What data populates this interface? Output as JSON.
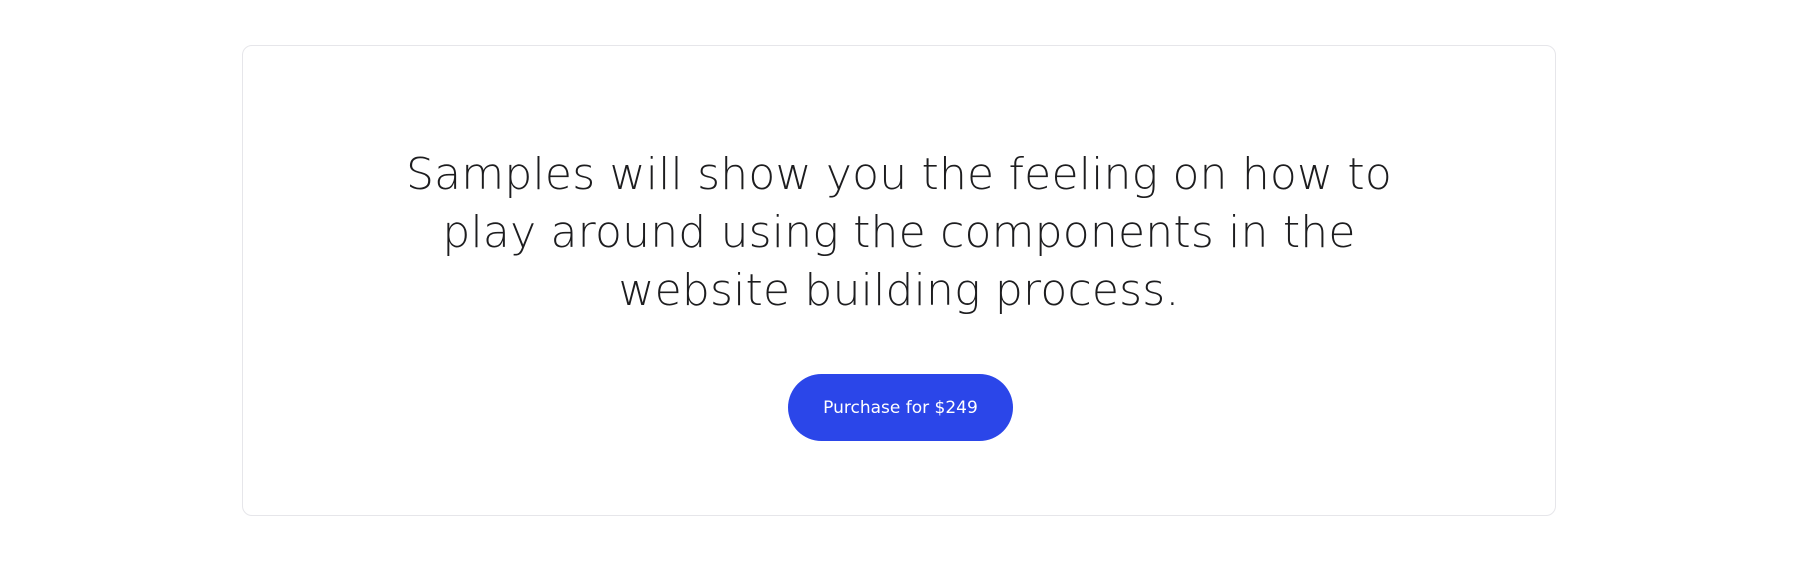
{
  "hero_card": {
    "headline": "Samples will show you the feeling on how to play around using the components in the website building process.",
    "cta_label": "Purchase for $249"
  },
  "colors": {
    "accent": "#2b46e9",
    "text": "#1d1d1f",
    "card_border": "#e6e6ea",
    "background": "#ffffff"
  }
}
